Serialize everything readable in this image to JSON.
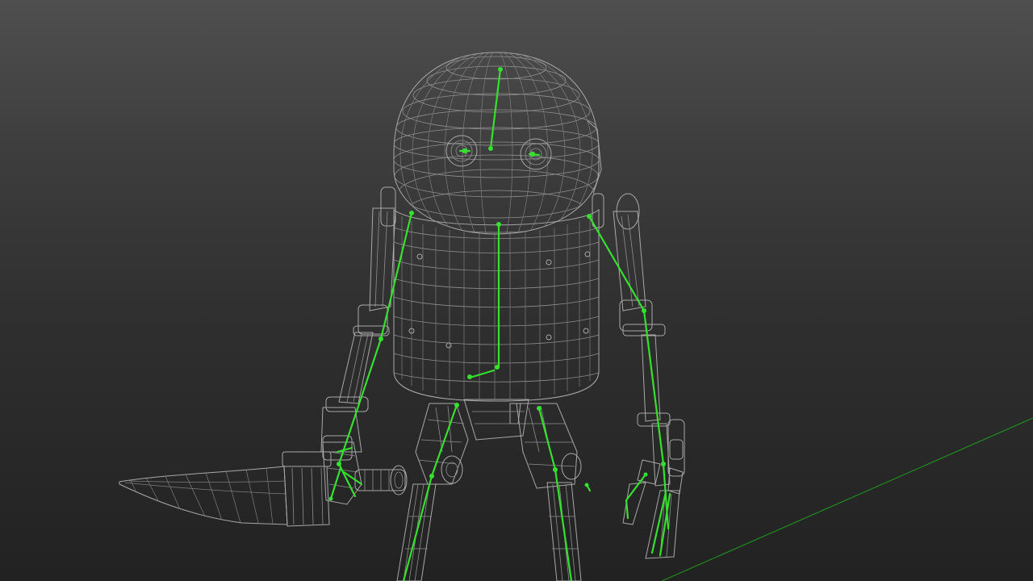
{
  "viewport": {
    "background_top": "#4f4f4f",
    "background_bottom": "#222222",
    "wireframe_color": "#a8a8a8",
    "skeleton_color": "#35e02f",
    "ground_axis_color": "#1f8a1f"
  },
  "scene": {
    "subject": "robot-wireframe-with-rig",
    "display_mode": "wireframe",
    "skeleton_visible": true
  }
}
